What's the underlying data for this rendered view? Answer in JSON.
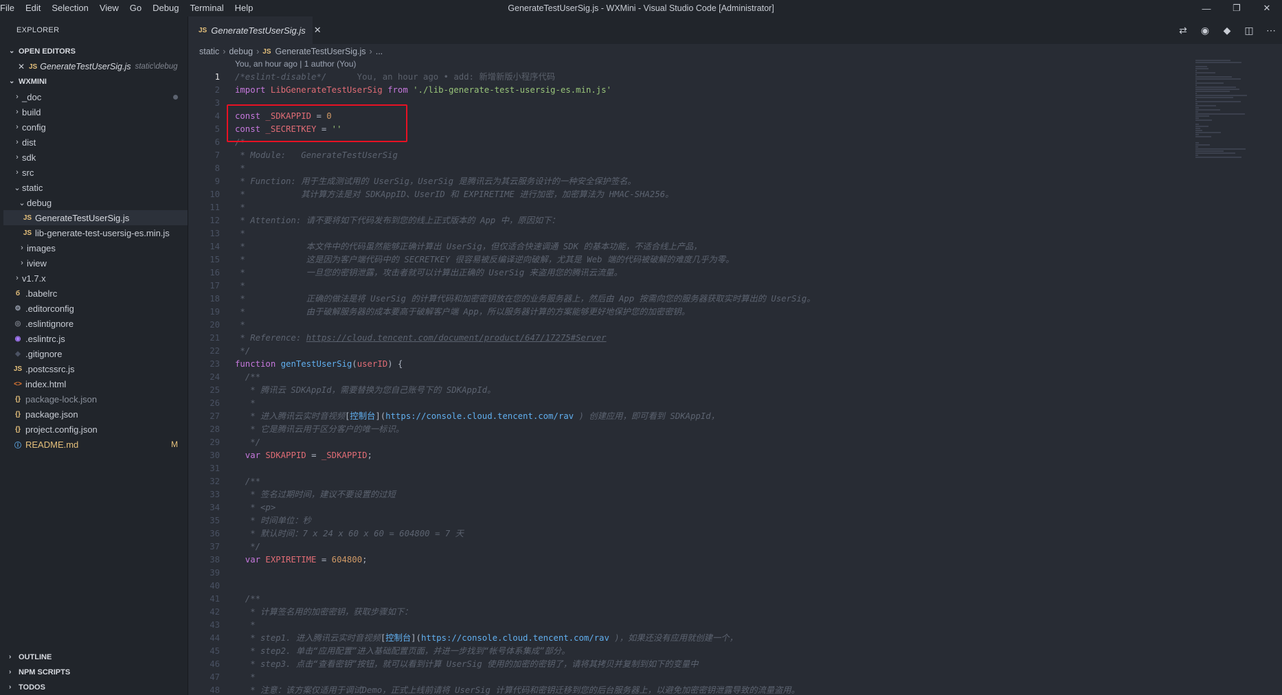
{
  "titlebar": {
    "menu": [
      "File",
      "Edit",
      "Selection",
      "View",
      "Go",
      "Debug",
      "Terminal",
      "Help"
    ],
    "title": "GenerateTestUserSig.js - WXMini - Visual Studio Code [Administrator]",
    "minimize": "—",
    "restore": "❐",
    "close": "✕"
  },
  "sidebar": {
    "title": "EXPLORER",
    "open_editors_label": "OPEN EDITORS",
    "open_editor": {
      "icon": "JS",
      "name": "GenerateTestUserSig.js",
      "path": "static\\debug"
    },
    "workspace_label": "WXMINI",
    "tree": [
      {
        "label": "_doc",
        "type": "folder",
        "depth": 0,
        "open": false,
        "dot": true
      },
      {
        "label": "build",
        "type": "folder",
        "depth": 0,
        "open": false
      },
      {
        "label": "config",
        "type": "folder",
        "depth": 0,
        "open": false
      },
      {
        "label": "dist",
        "type": "folder",
        "depth": 0,
        "open": false
      },
      {
        "label": "sdk",
        "type": "folder",
        "depth": 0,
        "open": false
      },
      {
        "label": "src",
        "type": "folder",
        "depth": 0,
        "open": false
      },
      {
        "label": "static",
        "type": "folder",
        "depth": 0,
        "open": true
      },
      {
        "label": "debug",
        "type": "folder",
        "depth": 1,
        "open": true
      },
      {
        "label": "GenerateTestUserSig.js",
        "type": "js",
        "depth": 2,
        "selected": true
      },
      {
        "label": "lib-generate-test-usersig-es.min.js",
        "type": "js",
        "depth": 2
      },
      {
        "label": "images",
        "type": "folder",
        "depth": 1,
        "open": false
      },
      {
        "label": "iview",
        "type": "folder",
        "depth": 1,
        "open": false
      },
      {
        "label": "v1.7.x",
        "type": "folder",
        "depth": 0,
        "open": false
      },
      {
        "label": ".babelrc",
        "type": "babel",
        "depth": 0
      },
      {
        "label": ".editorconfig",
        "type": "gear",
        "depth": 0
      },
      {
        "label": ".eslintignore",
        "type": "eslint-gray",
        "depth": 0
      },
      {
        "label": ".eslintrc.js",
        "type": "eslint",
        "depth": 0
      },
      {
        "label": ".gitignore",
        "type": "git",
        "depth": 0
      },
      {
        "label": ".postcssrc.js",
        "type": "js",
        "depth": 0
      },
      {
        "label": "index.html",
        "type": "html",
        "depth": 0
      },
      {
        "label": "package-lock.json",
        "type": "json",
        "depth": 0,
        "dim": true
      },
      {
        "label": "package.json",
        "type": "json",
        "depth": 0
      },
      {
        "label": "project.config.json",
        "type": "json",
        "depth": 0
      },
      {
        "label": "README.md",
        "type": "info",
        "depth": 0,
        "modified": true,
        "badge": "M"
      }
    ],
    "bottom_sections": [
      "OUTLINE",
      "NPM SCRIPTS",
      "TODOS"
    ]
  },
  "tab": {
    "icon": "JS",
    "label": "GenerateTestUserSig.js",
    "close": "✕"
  },
  "breadcrumb": [
    "static",
    "debug",
    "GenerateTestUserSig.js",
    "..."
  ],
  "codelens": "You, an hour ago | 1 author (You)",
  "code_lines": [
    [
      [
        "c",
        "/*eslint-disable*/"
      ],
      [
        "blame",
        "      You, an hour ago • add: 新增新版小程序代码"
      ]
    ],
    [
      [
        "k",
        "import "
      ],
      [
        "v",
        "LibGenerateTestUserSig "
      ],
      [
        "k",
        "from "
      ],
      [
        "s",
        "'./lib-generate-test-usersig-es.min.js'"
      ]
    ],
    [],
    [
      [
        "k",
        "const "
      ],
      [
        "v",
        "_SDKAPPID "
      ],
      [
        "p",
        "= "
      ],
      [
        "n",
        "0"
      ]
    ],
    [
      [
        "k",
        "const "
      ],
      [
        "v",
        "_SECRETKEY "
      ],
      [
        "p",
        "= "
      ],
      [
        "s",
        "''"
      ]
    ],
    [
      [
        "c",
        "/*"
      ]
    ],
    [
      [
        "c",
        " * Module:   GenerateTestUserSig"
      ]
    ],
    [
      [
        "c",
        " *"
      ]
    ],
    [
      [
        "c",
        " * Function: 用于生成测试用的 UserSig，UserSig 是腾讯云为其云服务设计的一种安全保护签名。"
      ]
    ],
    [
      [
        "c",
        " *           其计算方法是对 SDKAppID、UserID 和 EXPIRETIME 进行加密，加密算法为 HMAC-SHA256。"
      ]
    ],
    [
      [
        "c",
        " *"
      ]
    ],
    [
      [
        "c",
        " * Attention: 请不要将如下代码发布到您的线上正式版本的 App 中，原因如下："
      ]
    ],
    [
      [
        "c",
        " *"
      ]
    ],
    [
      [
        "c",
        " *            本文件中的代码虽然能够正确计算出 UserSig，但仅适合快速调通 SDK 的基本功能，不适合线上产品，"
      ]
    ],
    [
      [
        "c",
        " *            这是因为客户端代码中的 SECRETKEY 很容易被反编译逆向破解，尤其是 Web 端的代码被破解的难度几乎为零。"
      ]
    ],
    [
      [
        "c",
        " *            一旦您的密钥泄露，攻击者就可以计算出正确的 UserSig 来盗用您的腾讯云流量。"
      ]
    ],
    [
      [
        "c",
        " *"
      ]
    ],
    [
      [
        "c",
        " *            正确的做法是将 UserSig 的计算代码和加密密钥放在您的业务服务器上，然后由 App 按需向您的服务器获取实时算出的 UserSig。"
      ]
    ],
    [
      [
        "c",
        " *            由于破解服务器的成本要高于破解客户端 App，所以服务器计算的方案能够更好地保护您的加密密钥。"
      ]
    ],
    [
      [
        "c",
        " *"
      ]
    ],
    [
      [
        "c",
        " * Reference: "
      ],
      [
        "u",
        "https://cloud.tencent.com/document/product/647/17275#Server"
      ]
    ],
    [
      [
        "c",
        " */"
      ]
    ],
    [
      [
        "k",
        "function "
      ],
      [
        "f",
        "genTestUserSig"
      ],
      [
        "p",
        "("
      ],
      [
        "v",
        "userID"
      ],
      [
        "p",
        ") {"
      ]
    ],
    [
      [
        "c",
        "  /**"
      ]
    ],
    [
      [
        "c",
        "   * 腾讯云 SDKAppId，需要替换为您自己账号下的 SDKAppId。"
      ]
    ],
    [
      [
        "c",
        "   *"
      ]
    ],
    [
      [
        "c",
        "   * 进入腾讯云实时音视频"
      ],
      [
        "p",
        "["
      ],
      [
        "f",
        "控制台"
      ],
      [
        "p",
        "]("
      ],
      [
        "f",
        "https://console.cloud.tencent.com/rav"
      ],
      [
        "c",
        " ) 创建应用，即可看到 SDKAppId，"
      ]
    ],
    [
      [
        "c",
        "   * 它是腾讯云用于区分客户的唯一标识。"
      ]
    ],
    [
      [
        "c",
        "   */"
      ]
    ],
    [
      [
        "k",
        "  var "
      ],
      [
        "v",
        "SDKAPPID "
      ],
      [
        "p",
        "= "
      ],
      [
        "v",
        "_SDKAPPID"
      ],
      [
        "p",
        ";"
      ]
    ],
    [],
    [
      [
        "c",
        "  /**"
      ]
    ],
    [
      [
        "c",
        "   * 签名过期时间，建议不要设置的过短"
      ]
    ],
    [
      [
        "c",
        "   * <p>"
      ]
    ],
    [
      [
        "c",
        "   * 时间单位：秒"
      ]
    ],
    [
      [
        "c",
        "   * 默认时间：7 x 24 x 60 x 60 = 604800 = 7 天"
      ]
    ],
    [
      [
        "c",
        "   */"
      ]
    ],
    [
      [
        "k",
        "  var "
      ],
      [
        "v",
        "EXPIRETIME "
      ],
      [
        "p",
        "= "
      ],
      [
        "n",
        "604800"
      ],
      [
        "p",
        ";"
      ]
    ],
    [],
    [],
    [
      [
        "c",
        "  /**"
      ]
    ],
    [
      [
        "c",
        "   * 计算签名用的加密密钥，获取步骤如下："
      ]
    ],
    [
      [
        "c",
        "   *"
      ]
    ],
    [
      [
        "c",
        "   * step1. 进入腾讯云实时音视频"
      ],
      [
        "p",
        "["
      ],
      [
        "f",
        "控制台"
      ],
      [
        "p",
        "]("
      ],
      [
        "f",
        "https://console.cloud.tencent.com/rav"
      ],
      [
        "c",
        " )，如果还没有应用就创建一个，"
      ]
    ],
    [
      [
        "c",
        "   * step2. 单击“应用配置”进入基础配置页面，并进一步找到“帐号体系集成”部分。"
      ]
    ],
    [
      [
        "c",
        "   * step3. 点击“查看密钥”按钮，就可以看到计算 UserSig 使用的加密的密钥了，请将其拷贝并复制到如下的变量中"
      ]
    ],
    [
      [
        "c",
        "   *"
      ]
    ],
    [
      [
        "c",
        "   * 注意：该方案仅适用于调试Demo，正式上线前请将 UserSig 计算代码和密钥迁移到您的后台服务器上，以避免加密密钥泄露导致的流量盗用。"
      ]
    ]
  ],
  "colors": {
    "background": "#282c34",
    "sidebar": "#21252b",
    "highlight_box": "#e81123",
    "badge_modified": "#e5c07b"
  }
}
